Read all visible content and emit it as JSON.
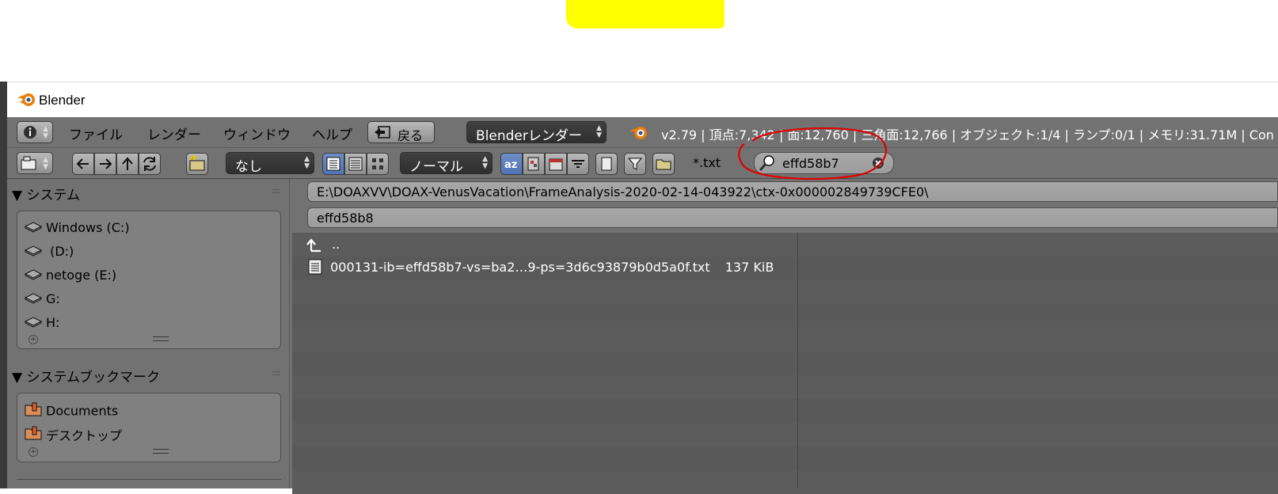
{
  "window": {
    "title": "Blender"
  },
  "menubar": {
    "items": [
      "ファイル",
      "レンダー",
      "ウィンドウ",
      "ヘルプ"
    ],
    "back_label": "戻る",
    "render_engine": "Blenderレンダー",
    "info": "v2.79 | 頂点:7,342 | 面:12,760 | 三角面:12,766 | オブジェクト:1/4 | ランプ:0/1 | メモリ:31.71M | Con"
  },
  "toolbar": {
    "recursion": "なし",
    "display": "ノーマル",
    "filter_text": "*.txt",
    "search_value": "effd58b7"
  },
  "sidebar": {
    "system_title": "システム",
    "drives": [
      {
        "label": "Windows (C:)",
        "icon": "drive-icon"
      },
      {
        "label": " (D:)",
        "icon": "drive-icon"
      },
      {
        "label": "netoge (E:)",
        "icon": "drive-icon"
      },
      {
        "label": "G:",
        "icon": "drive-icon"
      },
      {
        "label": "H:",
        "icon": "drive-icon"
      }
    ],
    "bookmarks_title": "システムブックマーク",
    "bookmarks": [
      {
        "label": "Documents",
        "icon": "bookmark-folder-icon"
      },
      {
        "label": "デスクトップ",
        "icon": "bookmark-folder-icon"
      }
    ]
  },
  "main": {
    "directory": "E:\\DOAXVV\\DOAX-VenusVacation\\FrameAnalysis-2020-02-14-043922\\ctx-0x000002849739CFE0\\",
    "filename": "effd58b8",
    "parent_label": "..",
    "files": [
      {
        "name": "000131-ib=effd58b7-vs=ba2…9-ps=3d6c93879b0d5a0f.txt",
        "size": "137 KiB"
      }
    ]
  },
  "colors": {
    "panel": "#727272",
    "highlight": "#ffff00",
    "annotation": "#e00000",
    "selected_button": "#5a7fc0"
  }
}
